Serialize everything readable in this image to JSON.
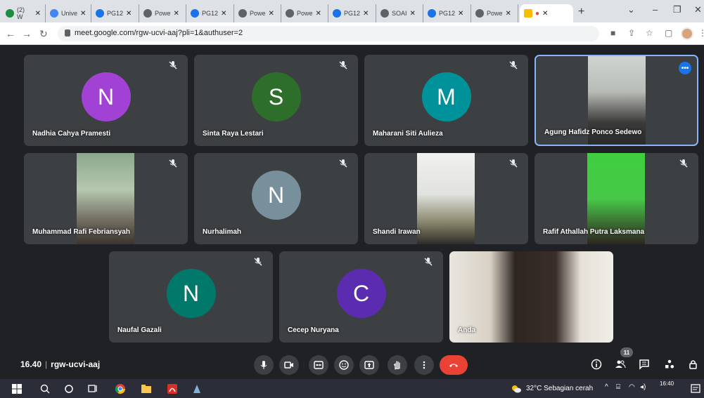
{
  "browser": {
    "tabs": [
      {
        "label": "(2) W",
        "color": "#1e8e3e"
      },
      {
        "label": "Unive",
        "color": "#4285f4"
      },
      {
        "label": "PG12",
        "color": "#1a73e8"
      },
      {
        "label": "Powe",
        "color": "#5f6368"
      },
      {
        "label": "PG12",
        "color": "#1a73e8"
      },
      {
        "label": "Powe",
        "color": "#5f6368"
      },
      {
        "label": "Powe",
        "color": "#5f6368"
      },
      {
        "label": "PG12",
        "color": "#1a73e8"
      },
      {
        "label": "SOAI",
        "color": "#5f6368"
      },
      {
        "label": "PG12",
        "color": "#1a73e8"
      },
      {
        "label": "Powe",
        "color": "#5f6368"
      },
      {
        "label": "",
        "color": "#fbbc04"
      }
    ],
    "url": "meet.google.com/rgw-ucvi-aaj?pli=1&authuser=2"
  },
  "participants": [
    {
      "name": "Nadhia Cahya Pramesti",
      "initial": "N",
      "color": "#a142d4"
    },
    {
      "name": "Sinta Raya Lestari",
      "initial": "S",
      "color": "#2d6e2a"
    },
    {
      "name": "Maharani Siti Aulieza",
      "initial": "M",
      "color": "#00929b"
    },
    {
      "name": "Agung Hafidz Ponco Sedewo",
      "initial": "",
      "color": ""
    },
    {
      "name": "Muhammad Rafi Febriansyah",
      "initial": "",
      "color": ""
    },
    {
      "name": "Nurhalimah",
      "initial": "N",
      "color": "#78909c"
    },
    {
      "name": "Shandi Irawan",
      "initial": "",
      "color": ""
    },
    {
      "name": "Rafif Athallah Putra Laksmana",
      "initial": "",
      "color": ""
    },
    {
      "name": "Naufal Gazali",
      "initial": "N",
      "color": "#00796b"
    },
    {
      "name": "Cecep Nuryana",
      "initial": "C",
      "color": "#5b2bb0"
    },
    {
      "name": "Anda",
      "initial": "",
      "color": ""
    }
  ],
  "meeting": {
    "time": "16.40",
    "code": "rgw-ucvi-aaj",
    "people_count": "11"
  },
  "taskbar": {
    "weather": "32°C  Sebagian cerah",
    "time": "16:40"
  }
}
